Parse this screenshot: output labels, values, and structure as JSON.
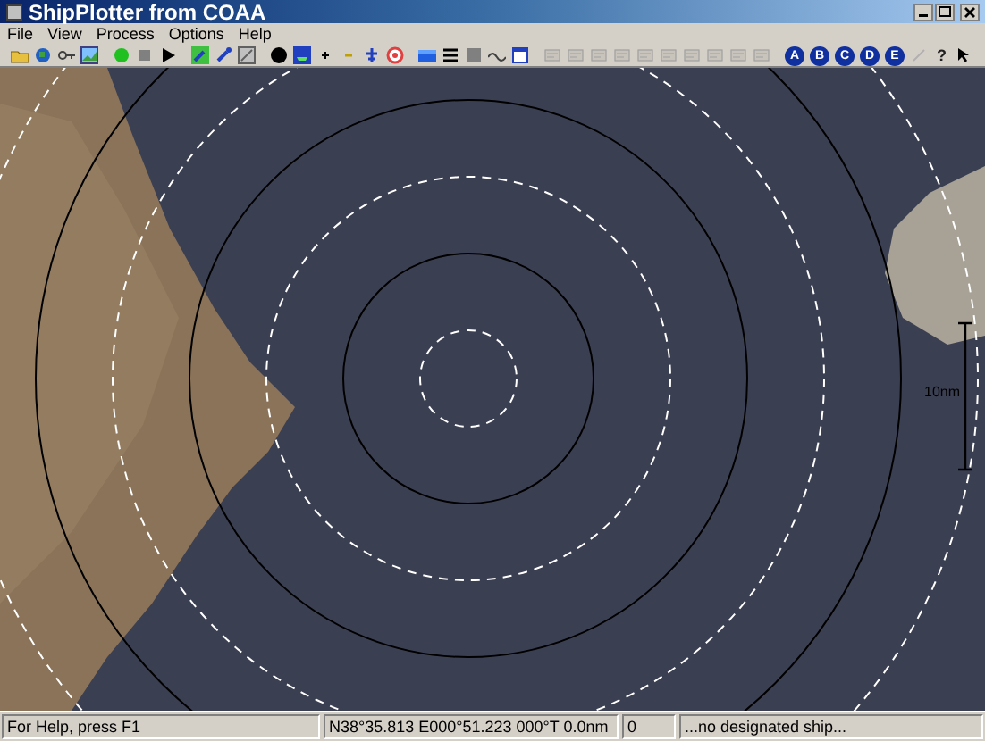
{
  "window": {
    "title": "ShipPlotter from COAA"
  },
  "menu": [
    "File",
    "View",
    "Process",
    "Options",
    "Help"
  ],
  "toolbar": {
    "letter_buttons": [
      "A",
      "B",
      "C",
      "D",
      "E"
    ],
    "help_glyph": "?"
  },
  "map": {
    "scale_label": "10nm"
  },
  "status_bar": [
    "For Help, press F1",
    "N38°35.813 E000°51.223 000°T 0.0nm",
    "0",
    "...no designated ship..."
  ]
}
